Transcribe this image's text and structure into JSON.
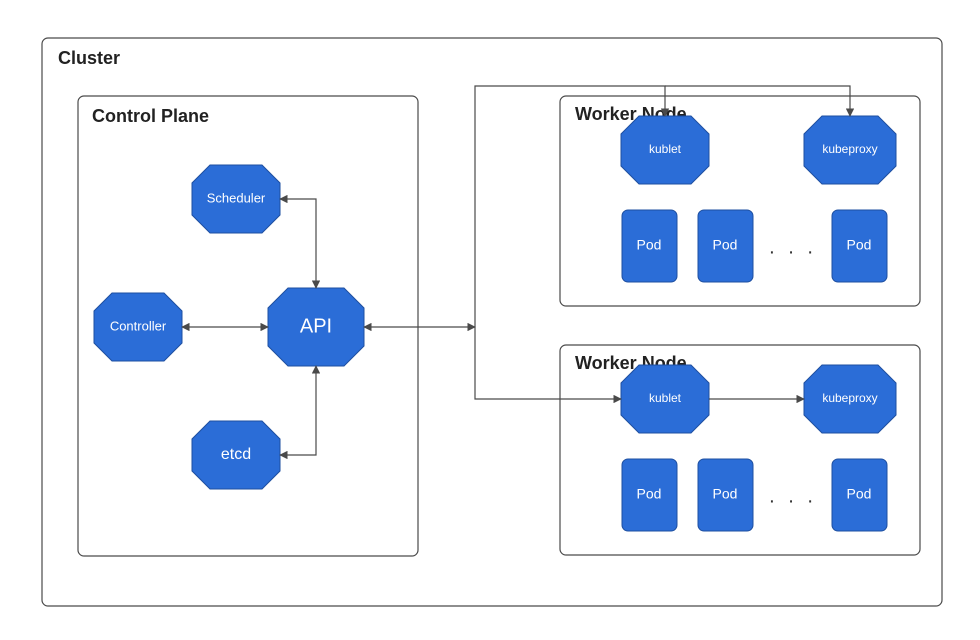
{
  "colors": {
    "shape_fill": "#2b6dd7",
    "shape_stroke": "#1e4fa0",
    "line": "#4a4a4a"
  },
  "cluster": {
    "title": "Cluster"
  },
  "control_plane": {
    "title": "Control Plane",
    "scheduler": {
      "label": "Scheduler"
    },
    "controller": {
      "label": "Controller"
    },
    "api": {
      "label": "API"
    },
    "etcd": {
      "label": "etcd"
    }
  },
  "worker_nodes": [
    {
      "title": "Worker Node",
      "kublet": {
        "label": "kublet"
      },
      "kubeproxy": {
        "label": "kubeproxy"
      },
      "pods": [
        "Pod",
        "Pod",
        "Pod"
      ],
      "ellipsis": ". . ."
    },
    {
      "title": "Worker Node",
      "kublet": {
        "label": "kublet"
      },
      "kubeproxy": {
        "label": "kubeproxy"
      },
      "pods": [
        "Pod",
        "Pod",
        "Pod"
      ],
      "ellipsis": ". . ."
    }
  ]
}
